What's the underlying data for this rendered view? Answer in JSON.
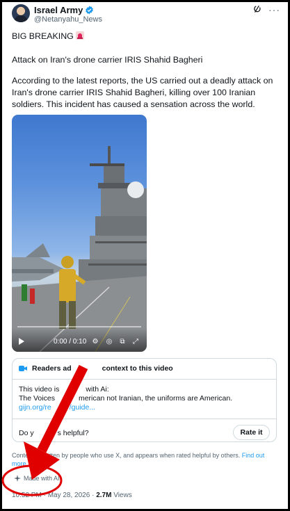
{
  "author": {
    "name": "Israel Army",
    "handle": "@Netanyahu_News"
  },
  "post": {
    "line1": "BIG BREAKING",
    "line2": "Attack on Iran's drone carrier IRIS Shahid Bagheri",
    "line3": "According to the latest reports, the US carried out a deadly attack on Iran's drone carrier IRIS Shahid Bagheri, killing over 100 Iranian soldiers. This incident has caused a sensation across the world."
  },
  "video": {
    "time": "0:00 / 0:10",
    "progress": 0
  },
  "community_note": {
    "title": "Readers added context to this video",
    "title_visible": "Readers ad",
    "title_visible_end": "context to this video",
    "body_line1": "This video is",
    "body_line1_end": "with Ai:",
    "body_line2": "The Voices",
    "body_line2_end": "merican not Iranian, the uniforms are American.",
    "link": "gijn.org/re",
    "link_end": "/guide...",
    "question": "Do y",
    "question_end": "s helpful?",
    "rate_label": "Rate it"
  },
  "context_note": {
    "text": "Context is written by people who use X, and appears when rated helpful by others.",
    "link": "Find out more"
  },
  "ai_label": "Made with AI",
  "meta": {
    "time": "10:52 PM",
    "date": "May 28, 2026",
    "views": "2.7M",
    "views_label": "Views"
  },
  "colors": {
    "accent": "#1d9bf0",
    "annotation": "#e00000"
  },
  "icons": [
    "verified-icon",
    "grok-icon",
    "more-icon",
    "siren-icon",
    "play-icon",
    "people-icon",
    "sparkle-icon"
  ]
}
